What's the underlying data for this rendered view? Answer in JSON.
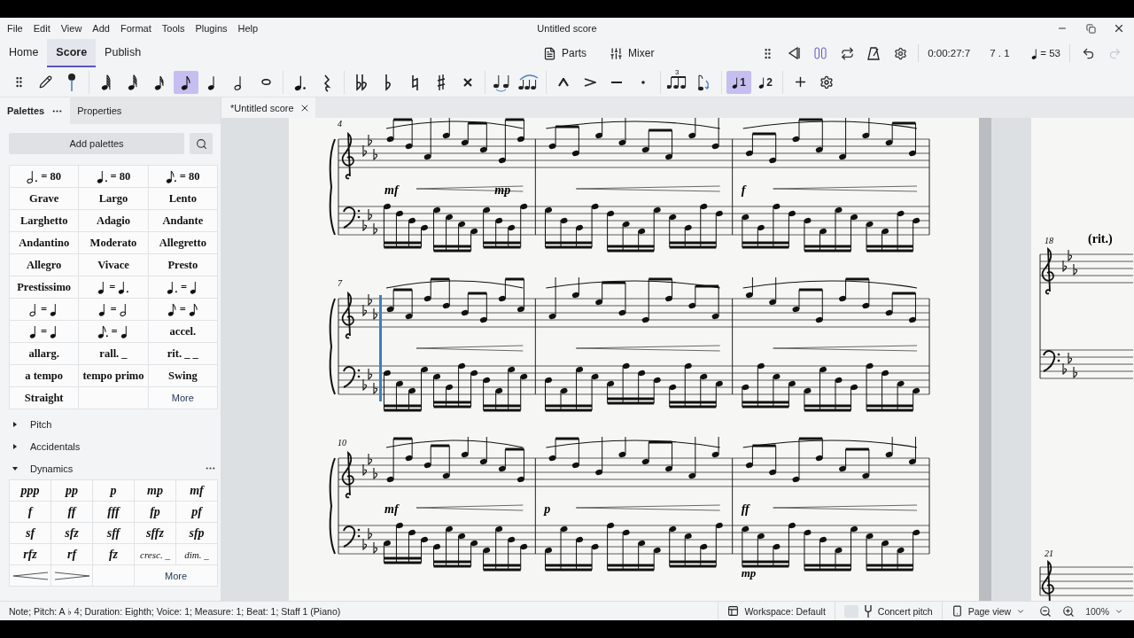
{
  "window": {
    "title": "Untitled score"
  },
  "menu": [
    "File",
    "Edit",
    "View",
    "Add",
    "Format",
    "Tools",
    "Plugins",
    "Help"
  ],
  "nav_tabs": [
    {
      "label": "Home",
      "selected": false
    },
    {
      "label": "Score",
      "selected": true
    },
    {
      "label": "Publish",
      "selected": false
    }
  ],
  "views": [
    {
      "kind": "parts",
      "label": "Parts"
    },
    {
      "kind": "mixer",
      "label": "Mixer"
    }
  ],
  "playback": {
    "time": "0:00:27:7",
    "position": "7 . 1",
    "tempo": "= 53",
    "redo": {
      "disabled": true
    }
  },
  "durations": [
    {
      "kind": "sixtyfourth",
      "selected": false
    },
    {
      "kind": "thirtysecond",
      "selected": false
    },
    {
      "kind": "sixteenth",
      "selected": false
    },
    {
      "kind": "eighth",
      "selected": true
    },
    {
      "kind": "quarter",
      "selected": false
    },
    {
      "kind": "half",
      "selected": false
    },
    {
      "kind": "whole",
      "selected": false
    }
  ],
  "tuplet": {
    "label": "3"
  },
  "voices": [
    {
      "label": "1",
      "selected": true
    },
    {
      "label": "2",
      "selected": false
    }
  ],
  "panel_tabs": [
    {
      "label": "Palettes",
      "selected": true
    },
    {
      "label": "Properties",
      "selected": false
    }
  ],
  "add_palettes": "Add palettes",
  "tempo_palette": [
    {
      "kind": "metronome",
      "note": {
        "kind": "half",
        "dotted": true
      },
      "label": "= 80"
    },
    {
      "kind": "metronome",
      "note": {
        "kind": "quarter",
        "dotted": true
      },
      "label": "= 80"
    },
    {
      "kind": "metronome",
      "note": {
        "kind": "eighth",
        "dotted": true
      },
      "label": "= 80"
    },
    {
      "kind": "text",
      "label": "Grave"
    },
    {
      "kind": "text",
      "label": "Largo"
    },
    {
      "kind": "text",
      "label": "Lento"
    },
    {
      "kind": "text",
      "label": "Larghetto"
    },
    {
      "kind": "text",
      "label": "Adagio"
    },
    {
      "kind": "text",
      "label": "Andante"
    },
    {
      "kind": "text",
      "label": "Andantino"
    },
    {
      "kind": "text",
      "label": "Moderato"
    },
    {
      "kind": "text",
      "label": "Allegretto"
    },
    {
      "kind": "text",
      "label": "Allegro"
    },
    {
      "kind": "text",
      "label": "Vivace"
    },
    {
      "kind": "text",
      "label": "Presto"
    },
    {
      "kind": "text",
      "label": "Prestissimo"
    },
    {
      "kind": "equation",
      "left": {
        "kind": "quarter",
        "dotted": false
      },
      "sign": "=",
      "right": {
        "kind": "quarter",
        "dotted": true
      }
    },
    {
      "kind": "equation",
      "left": {
        "kind": "quarter",
        "dotted": true
      },
      "sign": "=",
      "right": {
        "kind": "quarter",
        "dotted": false
      }
    },
    {
      "kind": "equation",
      "left": {
        "kind": "half",
        "dotted": false
      },
      "sign": "=",
      "right": {
        "kind": "quarter",
        "dotted": false
      }
    },
    {
      "kind": "equation",
      "left": {
        "kind": "quarter",
        "dotted": false
      },
      "sign": "=",
      "right": {
        "kind": "half",
        "dotted": false
      }
    },
    {
      "kind": "equation",
      "left": {
        "kind": "eighth",
        "dotted": false
      },
      "sign": "=",
      "right": {
        "kind": "eighth",
        "dotted": false
      }
    },
    {
      "kind": "equation",
      "left": {
        "kind": "quarter",
        "dotted": false
      },
      "sign": "=",
      "right": {
        "kind": "quarter",
        "dotted": false
      }
    },
    {
      "kind": "equation",
      "left": {
        "kind": "eighth",
        "dotted": true
      },
      "sign": "=",
      "right": {
        "kind": "quarter",
        "dotted": false
      }
    },
    {
      "kind": "text",
      "label": "accel."
    },
    {
      "kind": "text",
      "label": "allarg."
    },
    {
      "kind": "text",
      "label": "rall. _"
    },
    {
      "kind": "text",
      "label": "rit. _ _"
    },
    {
      "kind": "text",
      "label": "a tempo"
    },
    {
      "kind": "text",
      "label": "tempo primo"
    },
    {
      "kind": "text",
      "label": "Swing"
    },
    {
      "kind": "text",
      "label": "Straight"
    },
    {
      "kind": "empty"
    },
    {
      "kind": "more",
      "label": "More"
    }
  ],
  "palette_sections": [
    {
      "label": "Pitch",
      "expanded": false
    },
    {
      "label": "Accidentals",
      "expanded": false
    },
    {
      "label": "Dynamics",
      "expanded": true,
      "cells": [
        {
          "kind": "text",
          "label": "ppp"
        },
        {
          "kind": "text",
          "label": "pp"
        },
        {
          "kind": "text",
          "label": "p"
        },
        {
          "kind": "text",
          "label": "mp"
        },
        {
          "kind": "text",
          "label": "mf"
        },
        {
          "kind": "text",
          "label": "f"
        },
        {
          "kind": "text",
          "label": "ff"
        },
        {
          "kind": "text",
          "label": "fff"
        },
        {
          "kind": "text",
          "label": "fp"
        },
        {
          "kind": "text",
          "label": "pf"
        },
        {
          "kind": "text",
          "label": "sf"
        },
        {
          "kind": "text",
          "label": "sfz"
        },
        {
          "kind": "text",
          "label": "sff"
        },
        {
          "kind": "text",
          "label": "sffz"
        },
        {
          "kind": "text",
          "label": "sfp"
        },
        {
          "kind": "text",
          "label": "rfz"
        },
        {
          "kind": "text",
          "label": "rf"
        },
        {
          "kind": "text",
          "label": "fz"
        },
        {
          "kind": "text",
          "label": "cresc. _"
        },
        {
          "kind": "text",
          "label": "dim. _"
        },
        {
          "kind": "crescendo"
        },
        {
          "kind": "diminuendo"
        },
        {
          "kind": "empty"
        },
        {
          "kind": "more",
          "label": "More"
        }
      ]
    }
  ],
  "score_tab": {
    "label": "*Untitled score"
  },
  "score": {
    "systems": [
      {
        "measures": [
          {
            "number": "4",
            "dynamics": [
              "mf",
              "mp"
            ],
            "selected": false
          },
          {
            "selected": false
          },
          {
            "dynamics": [
              "f"
            ],
            "selected": false
          }
        ]
      },
      {
        "measures": [
          {
            "number": "7",
            "selected": true
          },
          {
            "selected": false
          },
          {
            "selected": false
          }
        ]
      },
      {
        "measures": [
          {
            "number": "10",
            "dynamics": [
              "mf"
            ],
            "selected": false
          },
          {
            "dynamics": [
              "p"
            ],
            "selected": false
          },
          {
            "dynamics": [
              "ff"
            ],
            "bass_dynamics": [
              "mp"
            ],
            "selected": false
          }
        ]
      }
    ]
  },
  "next_page": {
    "systems": [
      {
        "number": "18",
        "tempo": "(rit.)"
      },
      {
        "number": "21"
      }
    ]
  },
  "status_bar": {
    "text": "Note; Pitch: A ♭ 4; Duration: Eighth; Voice: 1; Measure: 1; Beat: 1; Staff 1 (Piano)",
    "workspace": "Workspace: Default",
    "concert_pitch": {
      "label": "Concert pitch",
      "on": false
    },
    "view": "Page view",
    "zoom": "100%"
  }
}
